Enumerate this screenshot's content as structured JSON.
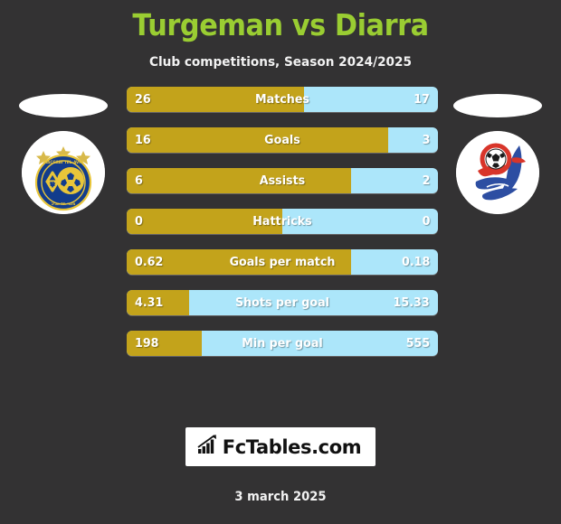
{
  "header": {
    "title": "Turgeman vs Diarra",
    "subtitle": "Club competitions, Season 2024/2025",
    "title_color": "#9acd32"
  },
  "theme": {
    "background": "#333233",
    "home_color": "#c3a31b",
    "away_color": "#ace6fa",
    "text_color": "#ffffff"
  },
  "home_club": {
    "badge_name": "maccabi-tel-aviv-badge"
  },
  "away_club": {
    "badge_name": "al-shabab-badge"
  },
  "stats": [
    {
      "label": "Matches",
      "home": "26",
      "away": "17",
      "home_pct": 57
    },
    {
      "label": "Goals",
      "home": "16",
      "away": "3",
      "home_pct": 84
    },
    {
      "label": "Assists",
      "home": "6",
      "away": "2",
      "home_pct": 72
    },
    {
      "label": "Hattricks",
      "home": "0",
      "away": "0",
      "home_pct": 50
    },
    {
      "label": "Goals per match",
      "home": "0.62",
      "away": "0.18",
      "home_pct": 72
    },
    {
      "label": "Shots per goal",
      "home": "4.31",
      "away": "15.33",
      "home_pct": 20
    },
    {
      "label": "Min per goal",
      "home": "198",
      "away": "555",
      "home_pct": 24
    }
  ],
  "footer": {
    "logo_text": "FcTables.com",
    "logo_icon": "bar-chart-arrow-icon",
    "date": "3 march 2025"
  }
}
